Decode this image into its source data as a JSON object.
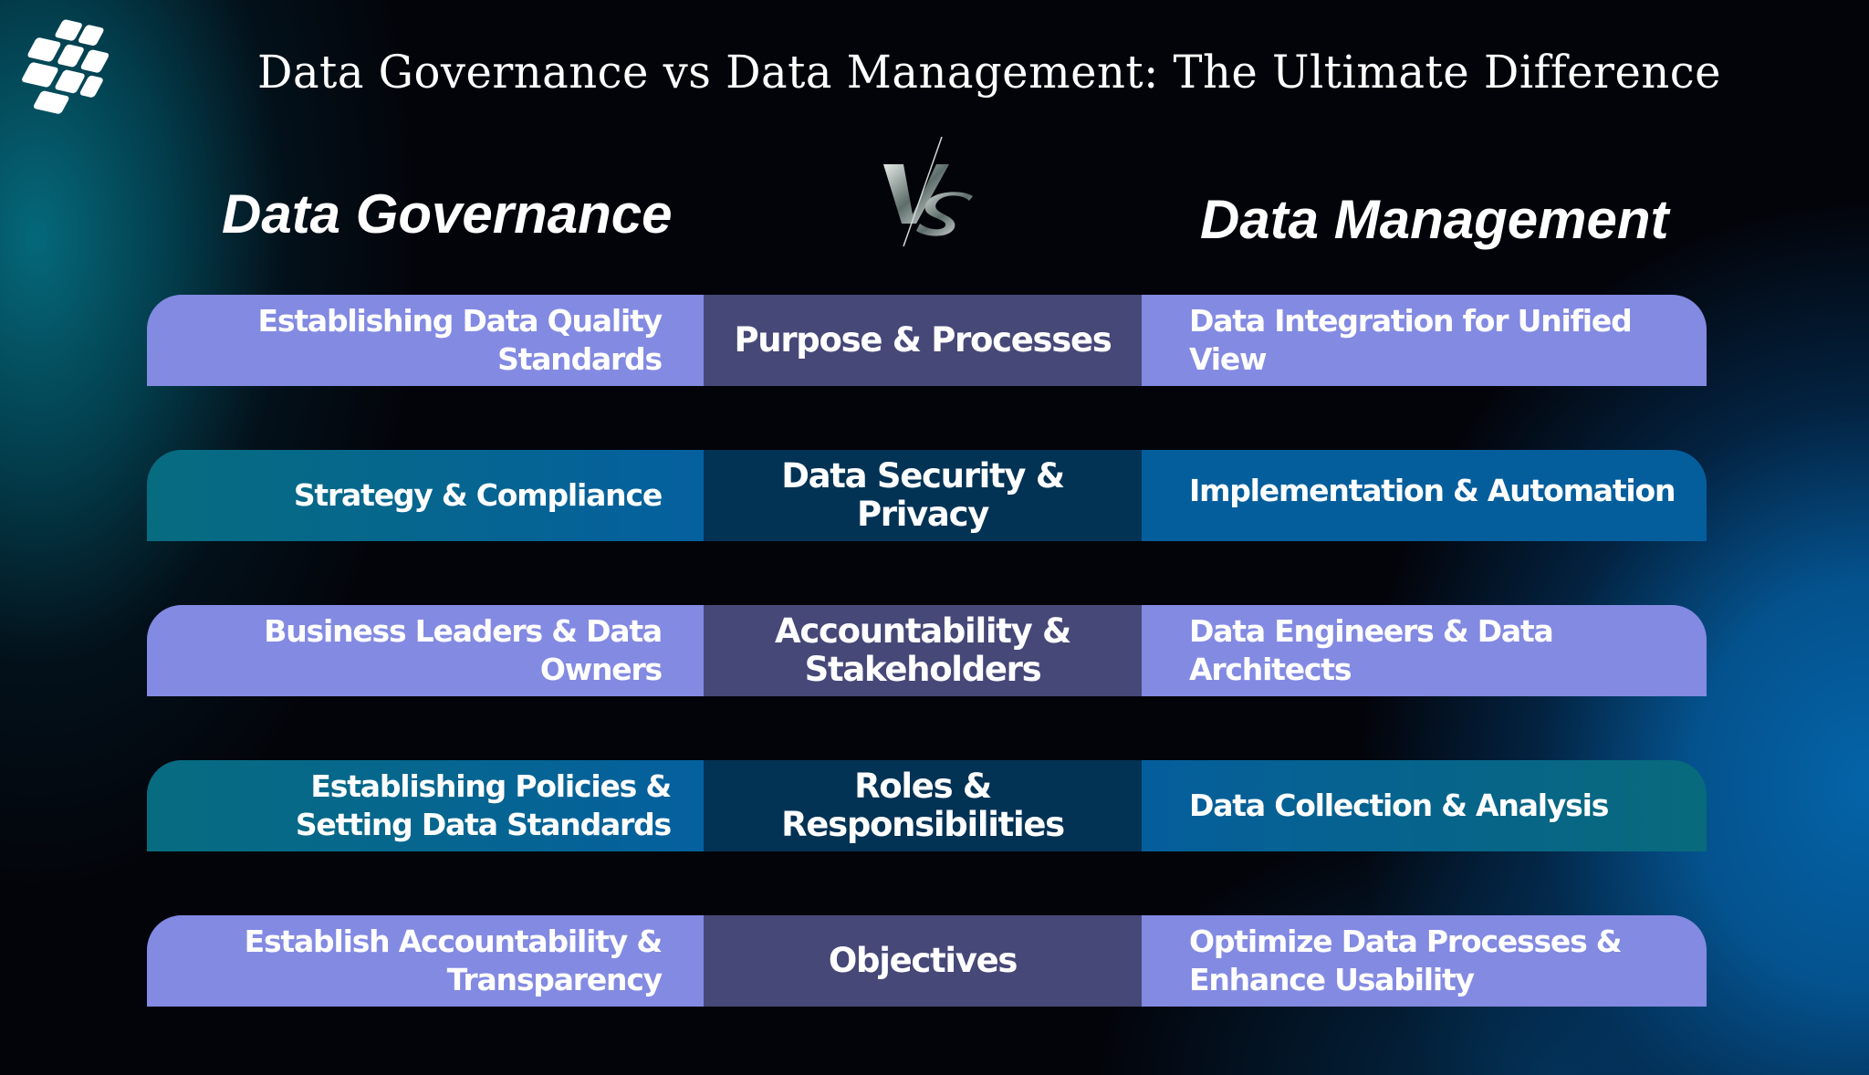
{
  "title": "Data Governance vs Data Management: The Ultimate Difference",
  "logo": {
    "icon": "company-logo-icon"
  },
  "headings": {
    "left": "Data Governance",
    "vs": "VS",
    "right": "Data Management"
  },
  "colors": {
    "purple_side": "#838ae2",
    "purple_center": "#464878",
    "teal_side_start": "#076c80",
    "blue_side": "#055e9c",
    "navy_center": "#023254",
    "background": "#03040a"
  },
  "rows": [
    {
      "style": "purple",
      "governance": "Establishing Data Quality Standards",
      "aspect": "Purpose & Processes",
      "management": "Data Integration for Unified View"
    },
    {
      "style": "teal",
      "governance": "Strategy & Compliance",
      "aspect": "Data Security & Privacy",
      "management": "Implementation & Automation"
    },
    {
      "style": "purple",
      "governance": "Business Leaders & Data Owners",
      "aspect": "Accountability & Stakeholders",
      "management": "Data Engineers & Data Architects"
    },
    {
      "style": "teal",
      "governance": "Establishing Policies & Setting Data Standards",
      "aspect": "Roles & Responsibilities",
      "management": "Data Collection & Analysis"
    },
    {
      "style": "purple",
      "governance": "Establish Accountability & Transparency",
      "aspect": "Objectives",
      "management": "Optimize Data Processes & Enhance Usability"
    }
  ]
}
